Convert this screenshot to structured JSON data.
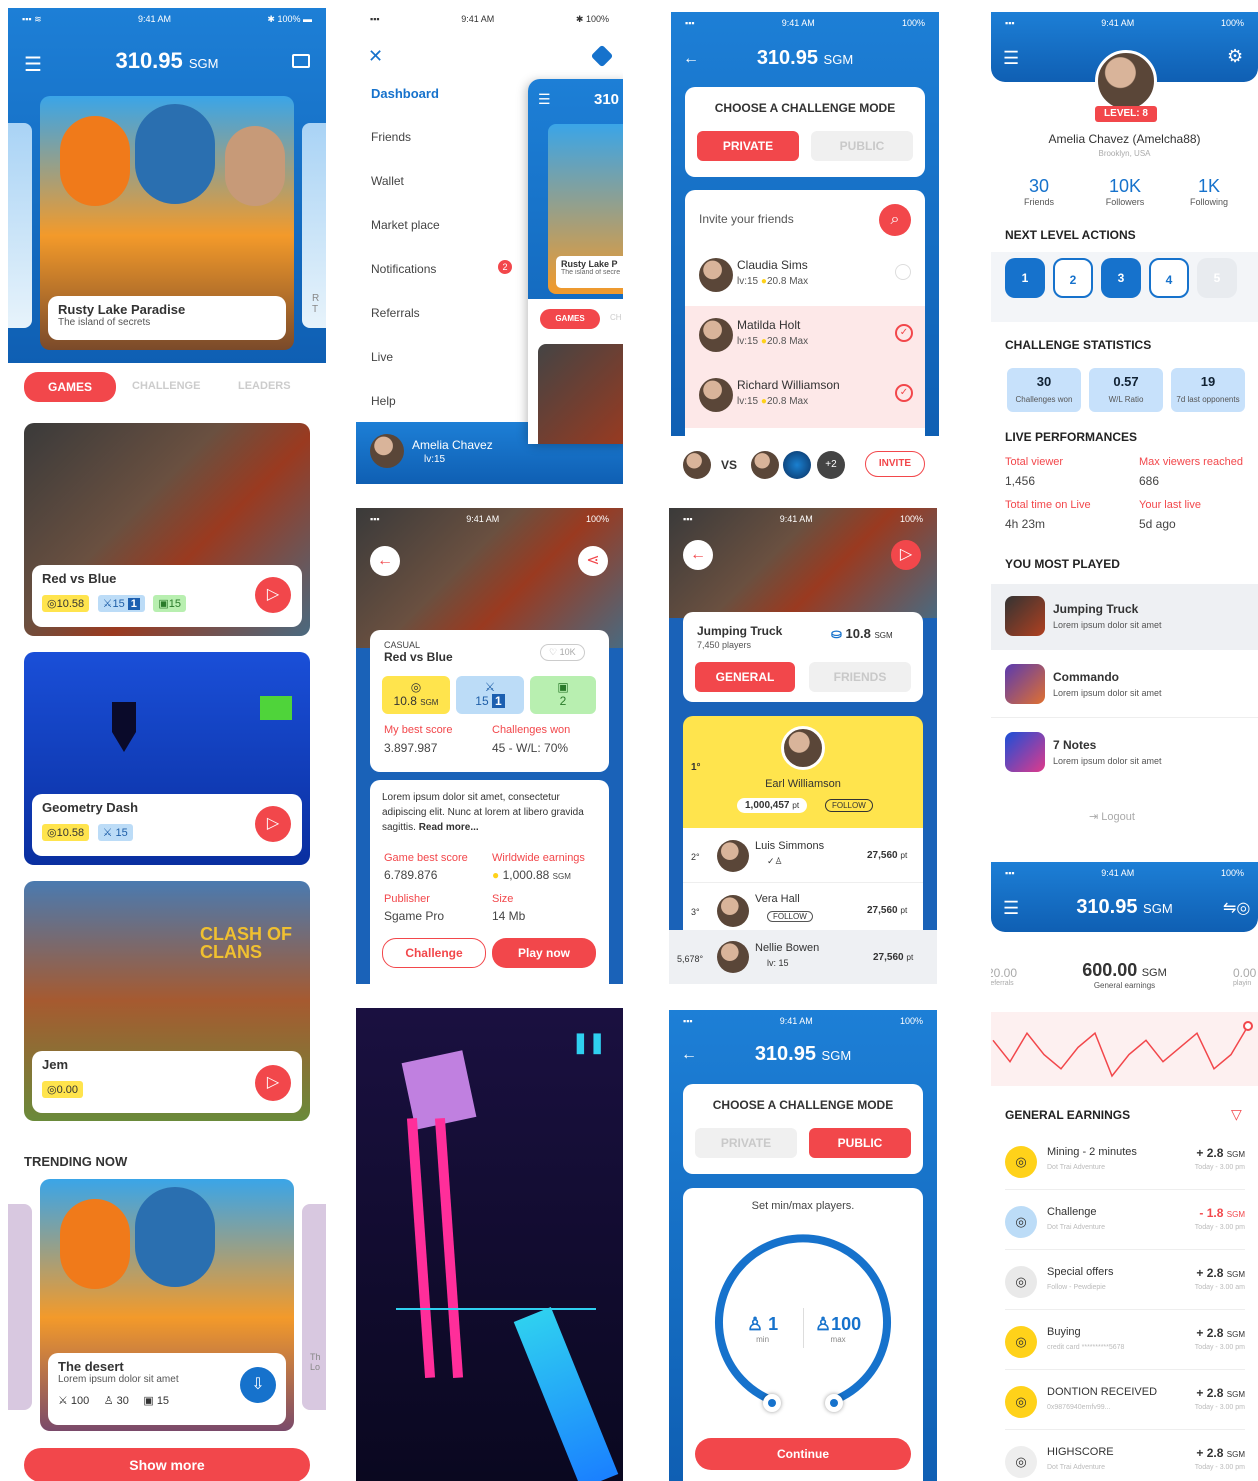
{
  "status": {
    "time": "9:41 AM",
    "battery": "100%"
  },
  "balance": {
    "amount": "310.95",
    "unit": "SGM",
    "general": "600.00",
    "general_label": "General earnings",
    "left_amount": "20.00",
    "left_label": "eferrals",
    "right_amount": "0.00",
    "right_label": "playin"
  },
  "home": {
    "featured_title": "Rusty Lake Paradise",
    "featured_sub": "The island of secrets",
    "tabs": [
      "GAMES",
      "CHALLENGE",
      "LEADERS"
    ],
    "games": [
      {
        "title": "Red vs Blue",
        "score": "10.58",
        "swords": "15",
        "badge": "1",
        "videos": "15"
      },
      {
        "title": "Geometry Dash",
        "score": "10.58",
        "swords": "15"
      },
      {
        "title": "Jem",
        "score": "0.00"
      }
    ],
    "trending_title": "TRENDING NOW",
    "trend_title": "The desert",
    "trend_sub": "Lorem ipsum dolor sit amet",
    "trend_stats": [
      "100",
      "30",
      "15"
    ],
    "show_more": "Show more",
    "clash_text": "CLASH OF CLANS",
    "ghost_sub": "R T",
    "ghost_sub2": "Th Lo"
  },
  "menu": {
    "items": [
      "Dashboard",
      "Friends",
      "Wallet",
      "Market place",
      "Notifications",
      "Referrals",
      "Live",
      "Help"
    ],
    "badge": "2",
    "user": "Amelia Chavez",
    "level": "lv:15",
    "preview_tab": "GAMES",
    "preview_tab2": "CH",
    "preview_title": "Rusty Lake P",
    "preview_sub": "The island of secre",
    "preview_balance": "310"
  },
  "detail": {
    "category": "CASUAL",
    "title": "Red vs Blue",
    "likes": "10K",
    "score": "10.8",
    "unit": "SGM",
    "swords": "15",
    "badge": "1",
    "count2": "2",
    "best_label": "My best score",
    "best": "3.897.987",
    "won_label": "Challenges won",
    "won": "45 - W/L: 70%",
    "desc": "Lorem ipsum dolor sit amet, consectetur adipiscing elit. Nunc at lorem at libero gravida sagittis.",
    "read_more": "Read more...",
    "gbest_label": "Game best score",
    "gbest": "6.789.876",
    "world_label": "Wirldwide earnings",
    "world": "1,000.88",
    "pub_label": "Publisher",
    "pub": "Sgame Pro",
    "size_label": "Size",
    "size": "14 Mb",
    "btn_challenge": "Challenge",
    "btn_play": "Play now"
  },
  "challenge": {
    "title": "CHOOSE A CHALLENGE MODE",
    "private": "PRIVATE",
    "public": "PUBLIC",
    "invite": "Invite your friends",
    "friends": [
      {
        "name": "Claudia Sims",
        "lv": "lv:15",
        "max": "20.8 Max"
      },
      {
        "name": "Matilda Holt",
        "lv": "lv:15",
        "max": "20.8 Max"
      },
      {
        "name": "Richard Williamson",
        "lv": "lv:15",
        "max": "20.8 Max"
      }
    ],
    "vs": "VS",
    "plus": "+2",
    "invite_btn": "INVITE"
  },
  "leader": {
    "game": "Jumping Truck",
    "players": "7,450 players",
    "score": "10.8",
    "tab_general": "GENERAL",
    "tab_friends": "FRIENDS",
    "rank1": "1°",
    "winner": "Earl Williamson",
    "winner_pts": "1,000,457",
    "pt": "pt",
    "follow": "FOLLOW",
    "rows": [
      {
        "rank": "2°",
        "name": "Luis Simmons",
        "pts": "27,560"
      },
      {
        "rank": "3°",
        "name": "Vera Hall",
        "pts": "27,560"
      },
      {
        "rank": "5,678°",
        "name": "Nellie Bowen",
        "pts": "27,560",
        "lv": "lv: 15"
      }
    ]
  },
  "minmax": {
    "title": "CHOOSE A CHALLENGE MODE",
    "private": "PRIVATE",
    "public": "PUBLIC",
    "set": "Set min/max players.",
    "min": "1",
    "min_label": "min",
    "max": "100",
    "max_label": "max",
    "continue": "Continue"
  },
  "profile": {
    "level": "LEVEL: 8",
    "name": "Amelia Chavez (Amelcha88)",
    "location": "Brooklyn, USA",
    "friends": "30",
    "friends_label": "Friends",
    "followers": "10K",
    "followers_label": "Followers",
    "following": "1K",
    "following_label": "Following",
    "next_title": "NEXT LEVEL ACTIONS",
    "levels": [
      "1",
      "2",
      "3",
      "4",
      "5"
    ],
    "stats_title": "CHALLENGE STATISTICS",
    "stats": [
      {
        "v": "30",
        "l": "Challenges won"
      },
      {
        "v": "0.57",
        "l": "W/L Ratio"
      },
      {
        "v": "19",
        "l": "7d last opponents"
      }
    ],
    "live_title": "LIVE PERFORMANCES",
    "live": [
      {
        "l": "Total viewer",
        "v": "1,456"
      },
      {
        "l": "Max viewers reached",
        "v": "686"
      },
      {
        "l": "Total time on Live",
        "v": "4h 23m"
      },
      {
        "l": "Your last live",
        "v": "5d ago"
      }
    ],
    "most_title": "YOU MOST PLAYED",
    "most": [
      {
        "t": "Jumping Truck",
        "s": "Lorem ipsum dolor sit amet"
      },
      {
        "t": "Commando",
        "s": "Lorem ipsum dolor sit amet"
      },
      {
        "t": "7 Notes",
        "s": "Lorem ipsum dolor sit amet"
      }
    ],
    "logout": "Logout"
  },
  "earnings": {
    "title": "GENERAL EARNINGS",
    "items": [
      {
        "t": "Mining - 2 minutes",
        "s": "Dot Trai Adventure",
        "v": "+ 2.8",
        "d": "Today - 3.00 pm",
        "color": "#ffd21a"
      },
      {
        "t": "Challenge",
        "s": "Dot Trai Adventure",
        "v": "- 1.8",
        "d": "Today - 3.00 pm",
        "color": "#bcdcf7"
      },
      {
        "t": "Special offers",
        "s": "Follow - Pewdiepie",
        "v": "+ 2.8",
        "d": "Today - 3.00 am",
        "color": "#e9e9e9"
      },
      {
        "t": "Buying",
        "s": "credit card **********5678",
        "v": "+ 2.8",
        "d": "Today - 3.00 pm",
        "color": "#ffd21a"
      },
      {
        "t": "DONTION RECEIVED",
        "s": "0x9876940emfv99...",
        "v": "+ 2.8",
        "d": "Today - 3.00 pm",
        "color": "#ffd21a"
      },
      {
        "t": "HIGHSCORE",
        "s": "Dot Trai Adventure",
        "v": "+ 2.8",
        "d": "Today - 3.00 pm",
        "color": "#eee"
      }
    ],
    "unit": "SGM",
    "chart_values": [
      8,
      5,
      9,
      6,
      4,
      7,
      9,
      3,
      6,
      8,
      5,
      7,
      9,
      4,
      6,
      10
    ]
  },
  "colors": {
    "accent": "#f2474b",
    "primary": "#1672cc",
    "yellow": "#ffd21a"
  }
}
